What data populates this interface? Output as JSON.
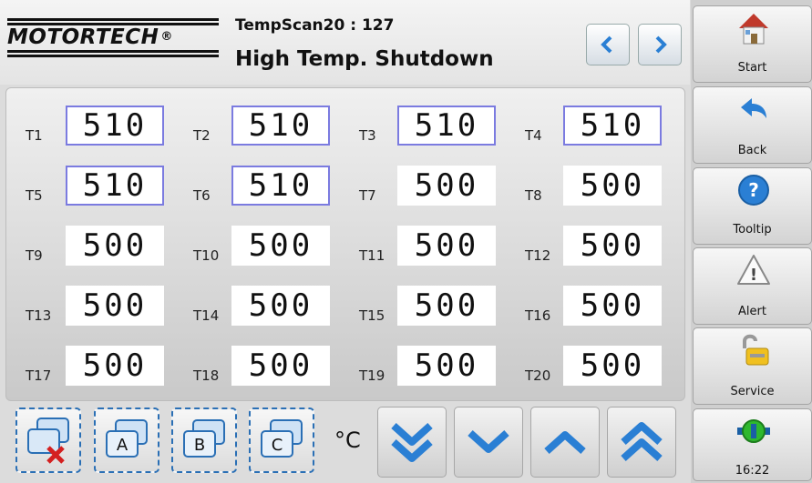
{
  "header": {
    "logo_text": "MOTORTECH",
    "logo_reg": "®",
    "device": "TempScan20 : 127",
    "title": "High Temp. Shutdown"
  },
  "sensors": [
    {
      "label": "T1",
      "value": "510",
      "alarm": true
    },
    {
      "label": "T2",
      "value": "510",
      "alarm": true
    },
    {
      "label": "T3",
      "value": "510",
      "alarm": true
    },
    {
      "label": "T4",
      "value": "510",
      "alarm": true
    },
    {
      "label": "T5",
      "value": "510",
      "alarm": true
    },
    {
      "label": "T6",
      "value": "510",
      "alarm": true
    },
    {
      "label": "T7",
      "value": "500",
      "alarm": false
    },
    {
      "label": "T8",
      "value": "500",
      "alarm": false
    },
    {
      "label": "T9",
      "value": "500",
      "alarm": false
    },
    {
      "label": "T10",
      "value": "500",
      "alarm": false
    },
    {
      "label": "T11",
      "value": "500",
      "alarm": false
    },
    {
      "label": "T12",
      "value": "500",
      "alarm": false
    },
    {
      "label": "T13",
      "value": "500",
      "alarm": false
    },
    {
      "label": "T14",
      "value": "500",
      "alarm": false
    },
    {
      "label": "T15",
      "value": "500",
      "alarm": false
    },
    {
      "label": "T16",
      "value": "500",
      "alarm": false
    },
    {
      "label": "T17",
      "value": "500",
      "alarm": false
    },
    {
      "label": "T18",
      "value": "500",
      "alarm": false
    },
    {
      "label": "T19",
      "value": "500",
      "alarm": false
    },
    {
      "label": "T20",
      "value": "500",
      "alarm": false
    }
  ],
  "toolbar": {
    "unit": "°C",
    "layer_a": "A",
    "layer_b": "B",
    "layer_c": "C"
  },
  "sidebar": {
    "start": "Start",
    "back": "Back",
    "tooltip": "Tooltip",
    "alert": "Alert",
    "service": "Service",
    "clock": "16:22"
  },
  "colors": {
    "alarm_border": "#7b7be0",
    "accent_blue": "#2a7fd4"
  }
}
